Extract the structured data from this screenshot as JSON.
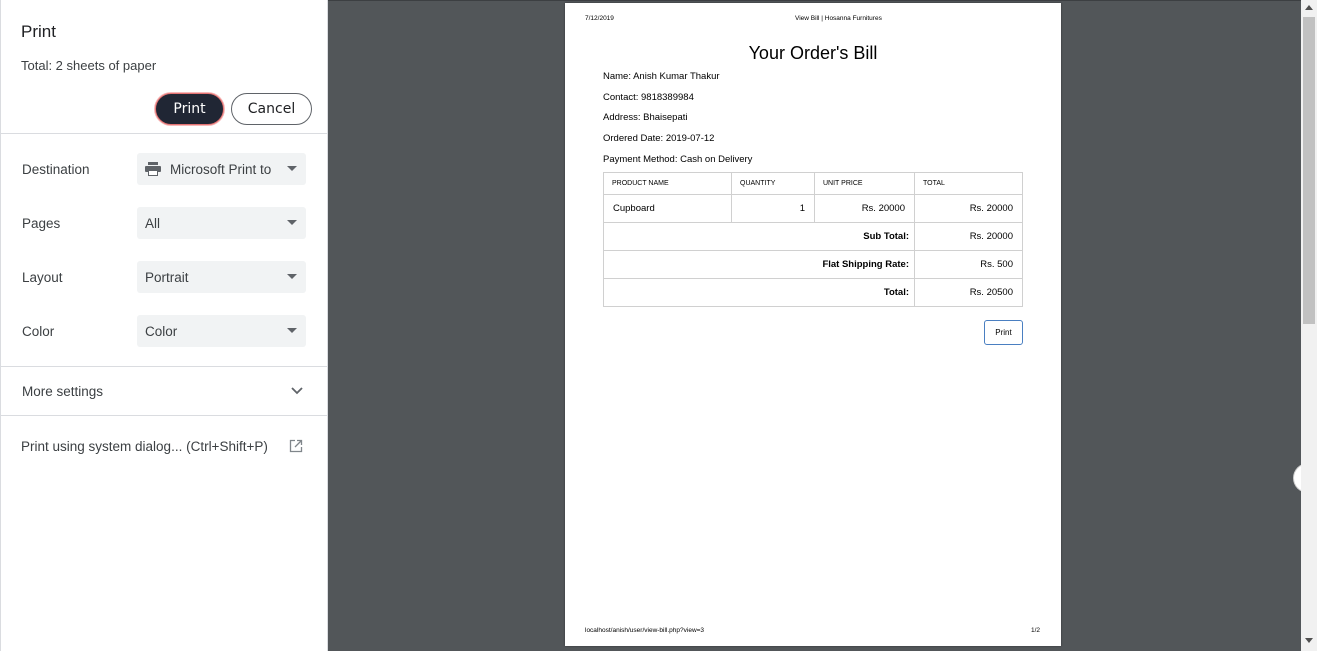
{
  "panel": {
    "title": "Print",
    "sheets": "Total: 2 sheets of paper",
    "print_label": "Print",
    "cancel_label": "Cancel",
    "settings": [
      {
        "label": "Destination",
        "value": "Microsoft Print to",
        "icon": "printer-icon"
      },
      {
        "label": "Pages",
        "value": "All"
      },
      {
        "label": "Layout",
        "value": "Portrait"
      },
      {
        "label": "Color",
        "value": "Color"
      }
    ],
    "more_settings": "More settings",
    "system_dialog": "Print using system dialog... (Ctrl+Shift+P)"
  },
  "preview": {
    "header_date": "7/12/2019",
    "header_title": "View Bill | Hosanna Furnitures",
    "footer_url": "localhost/anish/user/view-bill.php?view=3",
    "footer_page": "1/2",
    "bill_title": "Your Order's Bill",
    "info": [
      "Name: Anish Kumar Thakur",
      "Contact: 9818389984",
      "Address: Bhaisepati",
      "Ordered Date: 2019-07-12",
      "Payment Method: Cash on Delivery"
    ],
    "table": {
      "headers": [
        "PRODUCT NAME",
        "QUANTITY",
        "UNIT PRICE",
        "TOTAL"
      ],
      "row": {
        "product": "Cupboard",
        "quantity": "1",
        "unit_price": "Rs. 20000",
        "total": "Rs. 20000"
      },
      "subtotal_label": "Sub Total:",
      "subtotal_value": "Rs. 20000",
      "shipping_label": "Flat Shipping Rate:",
      "shipping_value": "Rs. 500",
      "total_label": "Total:",
      "total_value": "Rs. 20500"
    },
    "print_button": "Print"
  },
  "colors": {
    "print_button_bg": "#202634",
    "preview_bg": "#525659",
    "select_bg": "#f1f3f4"
  }
}
